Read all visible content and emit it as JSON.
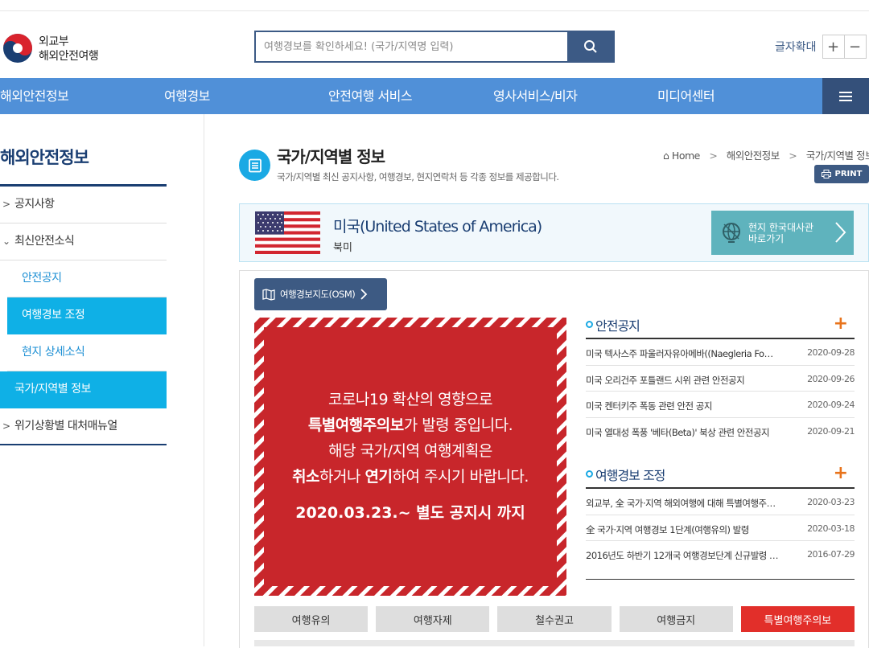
{
  "header": {
    "logo_line1": "외교부",
    "logo_line2": "해외안전여행",
    "search_placeholder": "여행경보를 확인하세요! (국가/지역명 입력)",
    "font_label": "글자확대",
    "font_plus": "+",
    "font_minus": "−"
  },
  "nav": {
    "items": [
      "해외안전정보",
      "여행경보",
      "안전여행 서비스",
      "영사서비스/비자",
      "미디어센터"
    ]
  },
  "sidebar": {
    "title": "해외안전정보",
    "items": [
      {
        "label": "공지사항"
      },
      {
        "label": "최신안전소식"
      },
      {
        "label": "안전공지"
      },
      {
        "label": "여행경보 조정"
      },
      {
        "label": "현지 상세소식"
      },
      {
        "label": "국가/지역별 정보"
      },
      {
        "label": "위기상황별 대처매뉴얼"
      }
    ]
  },
  "page": {
    "title": "국가/지역별 정보",
    "desc": "국가/지역별 최신 공지사항, 여행경보, 현지연락처 등 각종 정보를 제공합니다.",
    "crumb_home": "Home",
    "crumb_1": "해외안전정보",
    "crumb_2": "국가/지역별 정보",
    "print": "PRINT"
  },
  "country": {
    "name": "미국(United States of America)",
    "region": "북미",
    "embassy_line1": "현지 한국대사관",
    "embassy_line2": "바로가기"
  },
  "osm_button": "여행경보지도(OSM)",
  "notice": {
    "line1": "코로나19 확산의 영향으로",
    "line2_b": "특별여행주의보",
    "line2": "가 발령 중입니다.",
    "line3": "해당 국가/지역 여행계획은",
    "line4_b1": "취소",
    "line4_a": "하거나 ",
    "line4_b2": "연기",
    "line4_c": "하여 주시기 바랍니다.",
    "date": "2020.03.23.~ 별도 공지시 까지"
  },
  "safety": {
    "title": "안전공지",
    "items": [
      {
        "text": "미국 텍사스주 파울러자유아메바((Naegleria Fo…",
        "date": "2020-09-28"
      },
      {
        "text": "미국 오리건주 포틀랜드 시위 관련 안전공지",
        "date": "2020-09-26"
      },
      {
        "text": "미국 켄터키주 폭동 관련 안전 공지",
        "date": "2020-09-24"
      },
      {
        "text": "미국 열대성 폭풍 '베타(Beta)' 북상 관련 안전공지",
        "date": "2020-09-21"
      }
    ]
  },
  "adjust": {
    "title": "여행경보 조정",
    "items": [
      {
        "text": "외교부, 全 국가·지역 해외여행에 대해 특별여행주…",
        "date": "2020-03-23"
      },
      {
        "text": "全 국가·지역 여행경보 1단계(여행유의) 발령",
        "date": "2020-03-18"
      },
      {
        "text": "2016년도 하반기 12개국 여행경보단계 신규발령 …",
        "date": "2016-07-29"
      }
    ]
  },
  "levels": [
    "여행유의",
    "여행자제",
    "철수권고",
    "여행금지",
    "특별여행주의보"
  ],
  "colors": {
    "nav": "#5090d8",
    "navy": "#1a3e72",
    "accent": "#0fb0e6",
    "alert": "#c8262b",
    "plus": "#e8731b"
  }
}
